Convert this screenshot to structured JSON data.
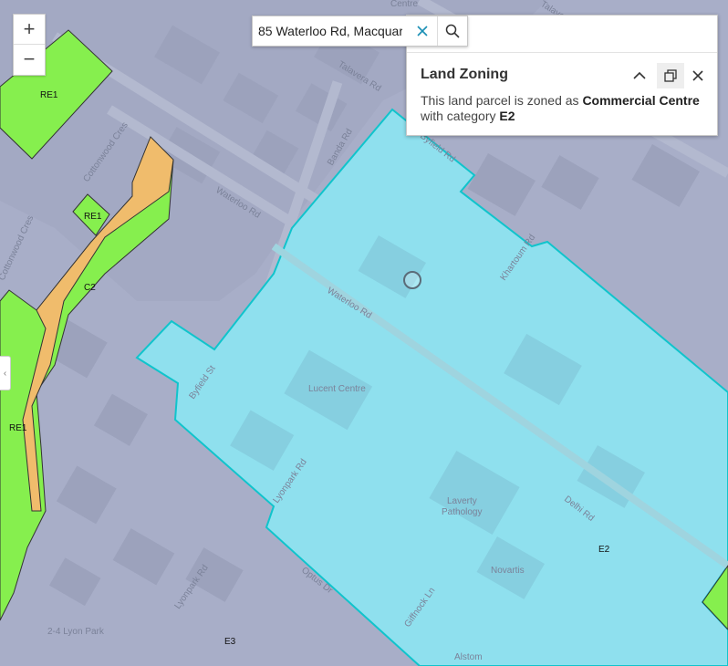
{
  "map": {
    "zone_labels": {
      "re1_a": "RE1",
      "re1_b": "RE1",
      "re1_c": "RE1",
      "c2": "C2",
      "e2": "E2",
      "e3": "E3"
    },
    "street_labels": {
      "waterloo_rd_a": "Waterloo Rd",
      "waterloo_rd_b": "Waterloo Rd",
      "talavera_rd": "Talavera Rd",
      "talavera_rd_top": "Talavera Rd",
      "banda_rd": "Banda Rd",
      "cottonwood_cres_a": "Cottonwood Cres",
      "cottonwood_cres_b": "Cottonwood Cres",
      "khartoum_rd": "Khartoum Rd",
      "byfield_st": "Byfield St",
      "lyonpark_rd_a": "Lyonpark Rd",
      "lyonpark_rd_b": "Lyonpark Rd",
      "giffnock_ln": "Giffnock Ln",
      "optus_dr": "Optus Dr",
      "delhi_rd": "Delhi Rd",
      "byfield_rd": "Byfield Rd"
    },
    "poi_labels": {
      "centre": "Centre",
      "lucent_centre": "Lucent Centre",
      "laverty": "Laverty",
      "pathology": "Pathology",
      "novartis": "Novartis",
      "lyon_park": "2-4 Lyon Park",
      "alstom": "Alstom"
    },
    "colors": {
      "base": "#a8aec8",
      "commercial_centre": "#8fe0ee",
      "commercial_outline": "#10c4cc",
      "recreation": "#86ef4e",
      "c2_zone": "#f0bc6c"
    }
  },
  "zoom": {
    "in_label": "+",
    "out_label": "−"
  },
  "collapse_icon": "chevron-left-icon",
  "search": {
    "value": "85 Waterloo Rd, Macquar..."
  },
  "popup": {
    "title": "Land Zoning",
    "body_prefix": "This land parcel is zoned as ",
    "zone_name": "Commercial Centre",
    "body_mid": "with category ",
    "category": "E2"
  }
}
